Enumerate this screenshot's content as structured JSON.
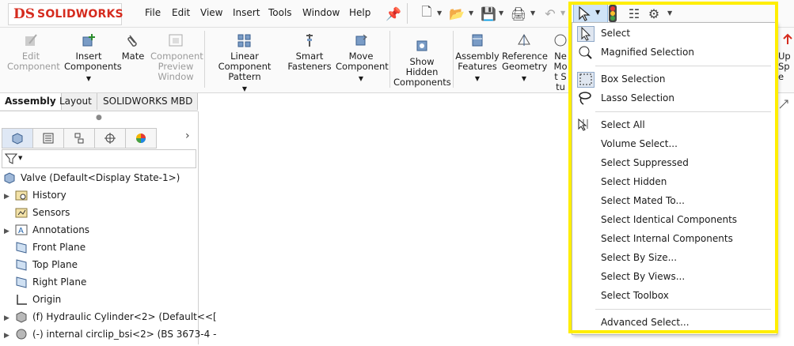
{
  "app": {
    "logo_mark": "DS",
    "logo_text": "SOLIDWORKS"
  },
  "menu": [
    "File",
    "Edit",
    "View",
    "Insert",
    "Tools",
    "Window",
    "Help"
  ],
  "ribbon": {
    "edit_component": "Edit Component",
    "insert_components": "Insert Components",
    "mate": "Mate",
    "component_preview": "Component Preview Window",
    "linear_pattern": "Linear Component Pattern",
    "smart_fasteners": "Smart Fasteners",
    "move_component": "Move Component",
    "show_hidden": "Show Hidden Components",
    "assembly_features": "Assembly Features",
    "reference_geometry": "Reference Geometry",
    "new_motion": "Ne Mot Stu",
    "update": "Up Spe"
  },
  "tabs": [
    "Assembly",
    "Layout",
    "SOLIDWORKS MBD"
  ],
  "tree": {
    "root": "Valve  (Default<Display State-1>)",
    "items": [
      {
        "label": "History",
        "expandable": true
      },
      {
        "label": "Sensors",
        "expandable": false
      },
      {
        "label": "Annotations",
        "expandable": true
      },
      {
        "label": "Front Plane",
        "expandable": false
      },
      {
        "label": "Top Plane",
        "expandable": false
      },
      {
        "label": "Right Plane",
        "expandable": false
      },
      {
        "label": "Origin",
        "expandable": false
      },
      {
        "label": "(f) Hydraulic Cylinder<2> (Default<<[",
        "expandable": true
      },
      {
        "label": "(-) internal circlip_bsi<2> (BS 3673-4 -",
        "expandable": true
      }
    ]
  },
  "dropdown": {
    "items": [
      "Select",
      "Magnified Selection",
      "Box Selection",
      "Lasso Selection",
      "Select All",
      "Volume Select...",
      "Select Suppressed",
      "Select Hidden",
      "Select Mated To...",
      "Select Identical Components",
      "Select Internal Components",
      "Select By Size...",
      "Select By Views...",
      "Select Toolbox",
      "Advanced Select..."
    ]
  },
  "colors": {
    "accent": "#d52b1e",
    "highlight": "#ffee00"
  }
}
